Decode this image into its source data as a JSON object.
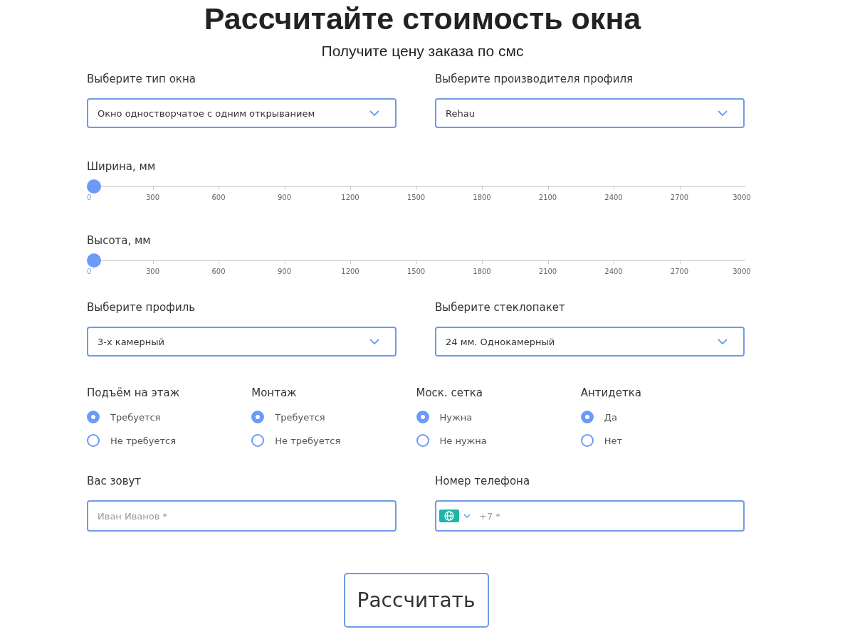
{
  "title": "Рассчитайте стоимость окна",
  "subtitle": "Получите цену заказа по смс",
  "selects_top": [
    {
      "label": "Выберите тип окна",
      "value": "Окно одностворчатое с одним открыванием"
    },
    {
      "label": "Выберите производителя профиля",
      "value": "Rehau"
    }
  ],
  "sliders": [
    {
      "label": "Ширина, мм",
      "level": 0,
      "ticks": [
        "0",
        "300",
        "600",
        "900",
        "1200",
        "1500",
        "1800",
        "2100",
        "2400",
        "2700",
        "3000"
      ]
    },
    {
      "label": "Высота, мм",
      "level": 0,
      "ticks": [
        "0",
        "300",
        "600",
        "900",
        "1200",
        "1500",
        "1800",
        "2100",
        "2400",
        "2700",
        "3000"
      ]
    }
  ],
  "selects_bottom": [
    {
      "label": "Выберите профиль",
      "value": "3-х камерный"
    },
    {
      "label": "Выберите стеклопакет",
      "value": "24 мм. Однокамерный"
    }
  ],
  "radio_groups": [
    {
      "label": "Подъём на этаж",
      "options": [
        {
          "label": "Требуется",
          "selected": true
        },
        {
          "label": "Не требуется",
          "selected": false
        }
      ]
    },
    {
      "label": "Монтаж",
      "options": [
        {
          "label": "Требуется",
          "selected": true
        },
        {
          "label": "Не требуется",
          "selected": false
        }
      ]
    },
    {
      "label": "Моск. сетка",
      "options": [
        {
          "label": "Нужна",
          "selected": true
        },
        {
          "label": "Не нужна",
          "selected": false
        }
      ]
    },
    {
      "label": "Антидетка",
      "options": [
        {
          "label": "Да",
          "selected": true
        },
        {
          "label": "Нет",
          "selected": false
        }
      ]
    }
  ],
  "name_field": {
    "label": "Вас зовут",
    "placeholder": "Иван Иванов *"
  },
  "phone_field": {
    "label": "Номер телефона",
    "placeholder": "+7 *"
  },
  "submit": "Рассчитать"
}
